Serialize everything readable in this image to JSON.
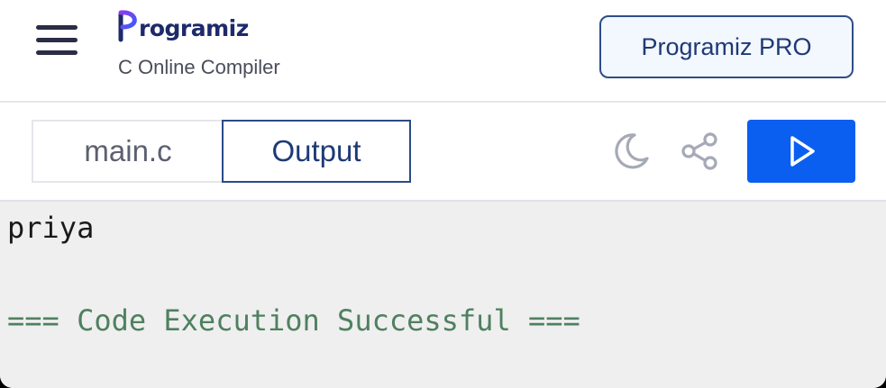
{
  "header": {
    "brand_name": "rogramiz",
    "subtitle": "C Online Compiler",
    "pro_button_label": "Programiz PRO",
    "menu_icon": "hamburger-menu-icon"
  },
  "toolbar": {
    "tabs": [
      {
        "label": "main.c",
        "active": false
      },
      {
        "label": "Output",
        "active": true
      }
    ],
    "icons": {
      "theme": "moon-icon",
      "share": "share-icon",
      "run": "play-icon"
    }
  },
  "output": {
    "lines": [
      "priya",
      "=== Code Execution Successful ==="
    ]
  },
  "colors": {
    "accent_blue": "#0b5ff0",
    "brand_navy": "#1e3a75",
    "success_green": "#4f8060",
    "output_background": "#efefef"
  }
}
